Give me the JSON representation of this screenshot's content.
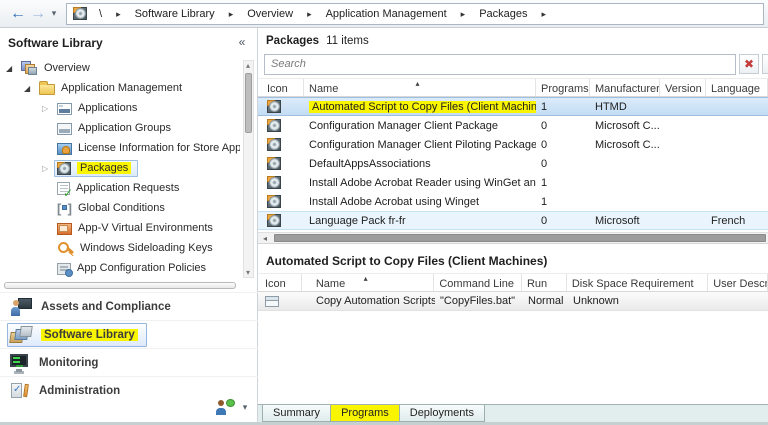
{
  "breadcrumb": {
    "root": "\\",
    "items": [
      "Software Library",
      "Overview",
      "Application Management",
      "Packages"
    ]
  },
  "sidebar": {
    "title": "Software Library",
    "tree": [
      {
        "label": "Overview"
      },
      {
        "label": "Application Management"
      },
      {
        "label": "Applications"
      },
      {
        "label": "Application Groups"
      },
      {
        "label": "License Information for Store Apps"
      },
      {
        "label": "Packages",
        "selected": true,
        "highlighted": true
      },
      {
        "label": "Application Requests"
      },
      {
        "label": "Global Conditions"
      },
      {
        "label": "App-V Virtual Environments"
      },
      {
        "label": "Windows Sideloading Keys"
      },
      {
        "label": "App Configuration Policies"
      }
    ],
    "nav": [
      {
        "label": "Assets and Compliance"
      },
      {
        "label": "Software Library",
        "selected": true,
        "highlighted": true
      },
      {
        "label": "Monitoring"
      },
      {
        "label": "Administration"
      }
    ]
  },
  "main": {
    "title": "Packages",
    "items_count": "11 items",
    "search": {
      "placeholder": "Search"
    },
    "list": {
      "columns": [
        "Icon",
        "Name",
        "Programs",
        "Manufacturer",
        "Version",
        "Language"
      ],
      "sort_column": "Name",
      "rows": [
        {
          "name": "Automated Script to Copy Files (Client Machin...",
          "programs": "1",
          "manufacturer": "HTMD",
          "version": "",
          "language": "",
          "selected": true,
          "highlighted": true
        },
        {
          "name": "Configuration Manager Client Package",
          "programs": "0",
          "manufacturer": "Microsoft C...",
          "version": "",
          "language": ""
        },
        {
          "name": "Configuration Manager Client Piloting Package",
          "programs": "0",
          "manufacturer": "Microsoft C...",
          "version": "",
          "language": ""
        },
        {
          "name": "DefaultAppsAssociations",
          "programs": "0",
          "manufacturer": "",
          "version": "",
          "language": ""
        },
        {
          "name": "Install Adobe Acrobat Reader using WinGet an...",
          "programs": "1",
          "manufacturer": "",
          "version": "",
          "language": ""
        },
        {
          "name": "Install Adobe Acrobat using Winget",
          "programs": "1",
          "manufacturer": "",
          "version": "",
          "language": ""
        },
        {
          "name": "Language Pack fr-fr",
          "programs": "0",
          "manufacturer": "Microsoft",
          "version": "",
          "language": "French",
          "hover": true
        }
      ]
    },
    "detail": {
      "title": "Automated Script to Copy Files (Client Machines)",
      "columns": [
        "Icon",
        "Name",
        "Command Line",
        "Run",
        "Disk Space Requirement",
        "User Description"
      ],
      "rows": [
        {
          "name": "Copy Automation Scripts",
          "command_line": "\"CopyFiles.bat\"",
          "run": "Normal",
          "disk_space": "Unknown",
          "user_description": ""
        }
      ]
    },
    "tabs": [
      {
        "label": "Summary"
      },
      {
        "label": "Programs",
        "active": true,
        "highlighted": true
      },
      {
        "label": "Deployments"
      }
    ]
  },
  "colors": {
    "annotation_highlight": "#f9f400",
    "selection_fill": "#cde3f7",
    "selection_border": "#9ebfe0",
    "tabstrip_background": "#e2eeee"
  }
}
